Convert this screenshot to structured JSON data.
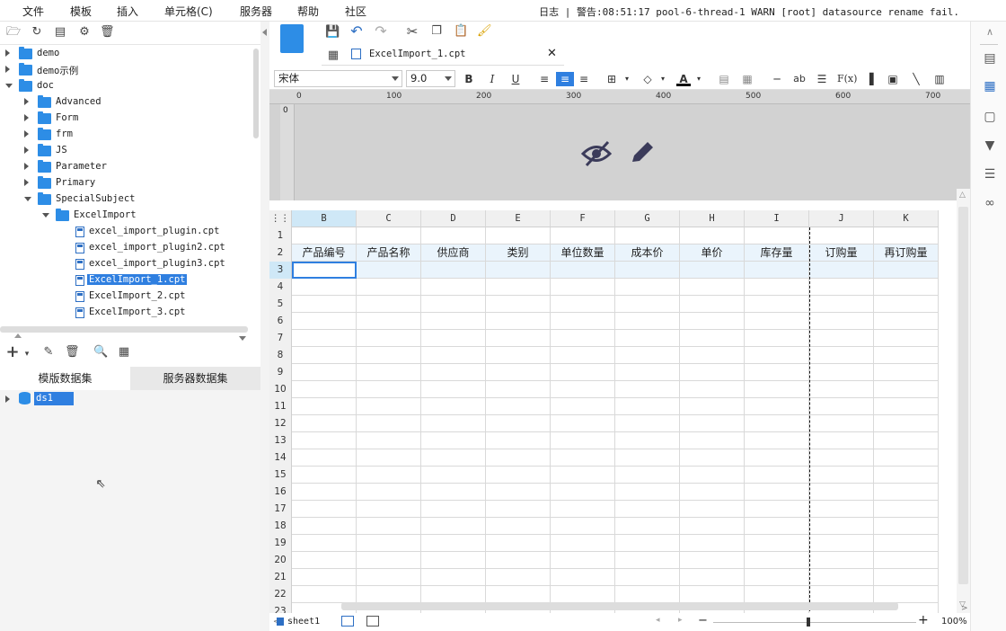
{
  "menu": [
    "文件",
    "模板",
    "插入",
    "单元格(C)",
    "服务器",
    "帮助",
    "社区"
  ],
  "status": {
    "log_label": "日志",
    "message": "警告:08:51:17 pool-6-thread-1 WARN [root] datasource rename fail."
  },
  "tree": [
    {
      "label": "demo",
      "type": "folder",
      "level": 0,
      "state": "closed"
    },
    {
      "label": "demo示例",
      "type": "folder",
      "level": 0,
      "state": "closed"
    },
    {
      "label": "doc",
      "type": "folder",
      "level": 0,
      "state": "open"
    },
    {
      "label": "Advanced",
      "type": "folder",
      "level": 1,
      "state": "closed"
    },
    {
      "label": "Form",
      "type": "folder",
      "level": 1,
      "state": "closed"
    },
    {
      "label": "frm",
      "type": "folder",
      "level": 1,
      "state": "closed"
    },
    {
      "label": "JS",
      "type": "folder",
      "level": 1,
      "state": "closed"
    },
    {
      "label": "Parameter",
      "type": "folder",
      "level": 1,
      "state": "closed"
    },
    {
      "label": "Primary",
      "type": "folder",
      "level": 1,
      "state": "closed"
    },
    {
      "label": "SpecialSubject",
      "type": "folder",
      "level": 1,
      "state": "open"
    },
    {
      "label": "ExcelImport",
      "type": "folder",
      "level": 2,
      "state": "open"
    },
    {
      "label": "excel_import_plugin.cpt",
      "type": "file",
      "level": 3
    },
    {
      "label": "excel_import_plugin2.cpt",
      "type": "file",
      "level": 3
    },
    {
      "label": "excel_import_plugin3.cpt",
      "type": "file",
      "level": 3
    },
    {
      "label": "ExcelImport_1.cpt",
      "type": "file",
      "level": 3,
      "selected": true
    },
    {
      "label": "ExcelImport_2.cpt",
      "type": "file",
      "level": 3
    },
    {
      "label": "ExcelImport_3.cpt",
      "type": "file",
      "level": 3
    }
  ],
  "dataset_tabs": [
    "模版数据集",
    "服务器数据集"
  ],
  "datasets": [
    "ds1"
  ],
  "editor_tab": {
    "title": "ExcelImport_1.cpt"
  },
  "font": {
    "name": "宋体",
    "size": "9.0"
  },
  "ruler_marks": [
    "0",
    "100",
    "200",
    "300",
    "400",
    "500",
    "600",
    "700"
  ],
  "ruler_v_mark": "0",
  "columns": [
    "B",
    "C",
    "D",
    "E",
    "F",
    "G",
    "H",
    "I",
    "J",
    "K"
  ],
  "rows": [
    "1",
    "2",
    "3",
    "4",
    "5",
    "6",
    "7",
    "8",
    "9",
    "10",
    "11",
    "12",
    "13",
    "14",
    "15",
    "16",
    "17",
    "18",
    "19",
    "20",
    "21",
    "22",
    "23"
  ],
  "header_cells": [
    "产品编号",
    "产品名称",
    "供应商",
    "类别",
    "单位数量",
    "成本价",
    "单价",
    "库存量",
    "订购量",
    "再订购量"
  ],
  "sheet_tab": "sheet1",
  "zoom": "100%",
  "colors": {
    "accent": "#2f7fe0",
    "folder": "#2d8de6",
    "selected_col": "#cfe8f7"
  }
}
